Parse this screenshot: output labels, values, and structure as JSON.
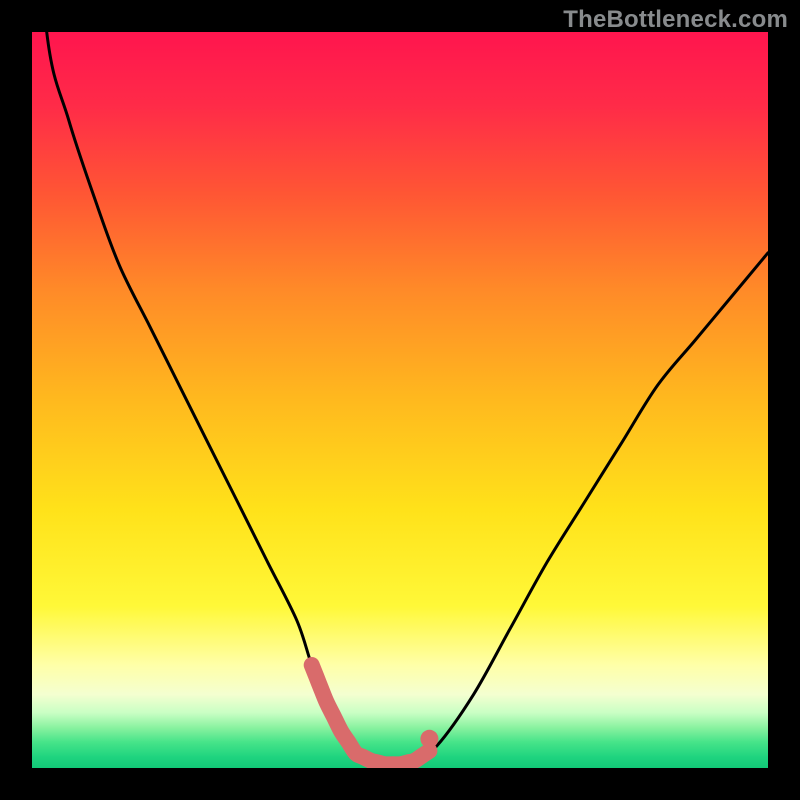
{
  "watermark": "TheBottleneck.com",
  "colors": {
    "background": "#000000",
    "highlight_stroke": "#d96b6b",
    "curve": "#000000",
    "gradient_top": "#ff1a4a",
    "gradient_mid1": "#ff7a2a",
    "gradient_mid2": "#ffe32a",
    "gradient_pale": "#ffffad",
    "gradient_green": "#1fe07a"
  },
  "chart_data": {
    "type": "line",
    "title": "",
    "xlabel": "",
    "ylabel": "",
    "xlim": [
      0,
      100
    ],
    "ylim": [
      0,
      100
    ],
    "x": [
      0,
      2,
      5,
      9,
      12,
      16,
      20,
      24,
      28,
      32,
      36,
      38,
      40,
      42,
      44,
      46,
      48,
      50,
      52,
      55,
      60,
      65,
      70,
      75,
      80,
      85,
      90,
      95,
      100
    ],
    "values": [
      130,
      100,
      88,
      76,
      68,
      60,
      52,
      44,
      36,
      28,
      20,
      14,
      9,
      5,
      2,
      1,
      0.5,
      0.5,
      1,
      3,
      10,
      19,
      28,
      36,
      44,
      52,
      58,
      64,
      70
    ],
    "highlight_range_x": [
      38,
      54
    ],
    "notes": "Approximate bottleneck-curve shape read from the image; x is a relative 0–100 axis, values are percent-style y readings (top of plot ≈ 100, bottom ≈ 0). Curve exceeds top frame at far left."
  }
}
